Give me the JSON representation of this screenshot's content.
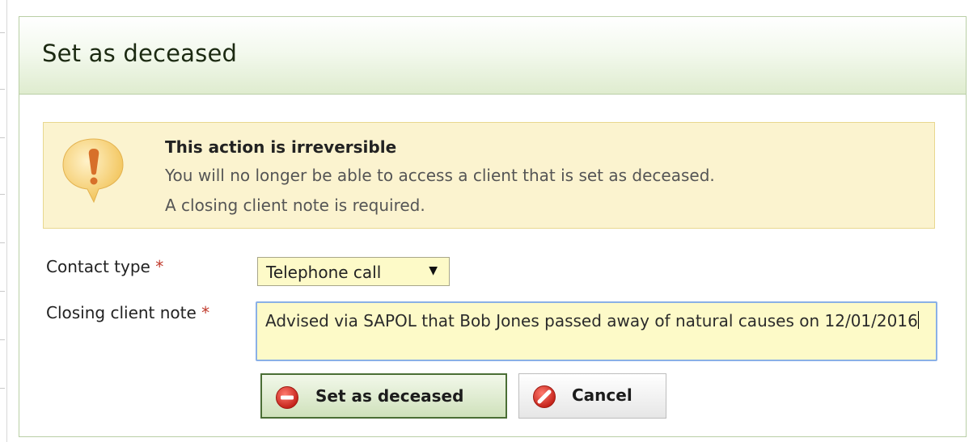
{
  "dialog": {
    "title": "Set as deceased"
  },
  "warning": {
    "title": "This action is irreversible",
    "line1": "You will no longer be able to access a client that is set as deceased.",
    "line2": "A closing client note is required.",
    "icon": "exclamation-speech-bubble-icon"
  },
  "form": {
    "contact_type": {
      "label": "Contact type",
      "required_mark": "*",
      "value": "Telephone call"
    },
    "closing_note": {
      "label": "Closing client note",
      "required_mark": "*",
      "value": "Advised via SAPOL that Bob Jones passed away of natural causes on 12/01/2016"
    }
  },
  "buttons": {
    "confirm": {
      "label": "Set as deceased",
      "icon": "minus-circle-icon"
    },
    "cancel": {
      "label": "Cancel",
      "icon": "no-entry-icon"
    }
  },
  "colors": {
    "header_gradient_end": "#dfeccf",
    "warning_background": "#fbf3cf",
    "input_background": "#fdfac8",
    "focus_border": "#8ab0e6",
    "danger_red": "#d9322b"
  }
}
